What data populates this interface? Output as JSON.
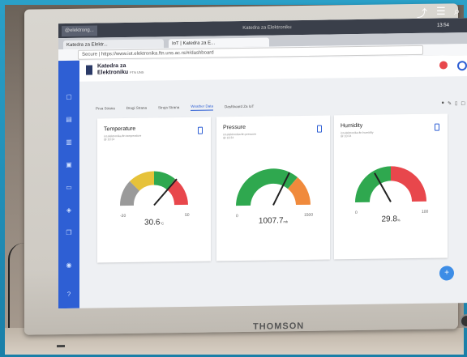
{
  "os": {
    "tab1": "@elektrong...",
    "title": "Katedra za Elektroniku",
    "clock": "13:54"
  },
  "browser": {
    "tabs": [
      {
        "label": "Katedra za Elektr..."
      },
      {
        "label": "IoT | Katedra za E..."
      }
    ],
    "url": "Secure | https://www.iot.elektronika.ftn.uns.ac.rs/#/dashboard"
  },
  "app": {
    "org_line1": "Katedra za",
    "org_line2": "Elektroniku",
    "org_small": "FTN UNS",
    "tabs": [
      "Prva Strana",
      "Drugi Strana",
      "Struja Strana",
      "Weather Data",
      "Dashboard Za IoT"
    ],
    "selected_tab_index": 3
  },
  "cards": [
    {
      "title": "Temperature",
      "sub": "iot.elektronika.ftn temperature",
      "sub2": "@ 10:34",
      "value": "30.6",
      "unit": "°C",
      "min": "-20",
      "max": "50",
      "level": 0.72
    },
    {
      "title": "Pressure",
      "sub": "iot.elektronika.ftn pressure",
      "sub2": "@ 10:34",
      "value": "1007.7",
      "unit": "mb",
      "min": "0",
      "max": "1500",
      "level": 0.67
    },
    {
      "title": "Humidity",
      "sub": "iot.elektronika.ftn humidity",
      "sub2": "@ 10:34",
      "value": "29.8",
      "unit": "%",
      "min": "0",
      "max": "100",
      "level": 0.3
    }
  ],
  "monitor_brand": "THOMSON",
  "colors": {
    "sidebar": "#2e5fd4",
    "gauge_green": "#2fa84f",
    "gauge_red": "#e8474c",
    "gauge_yellow": "#e6c23a",
    "gauge_gray": "#9a9a9a",
    "gauge_orange": "#f08a3c"
  },
  "icons": [
    "share-icon",
    "settings-sliders-icon",
    "zoom-icon"
  ]
}
